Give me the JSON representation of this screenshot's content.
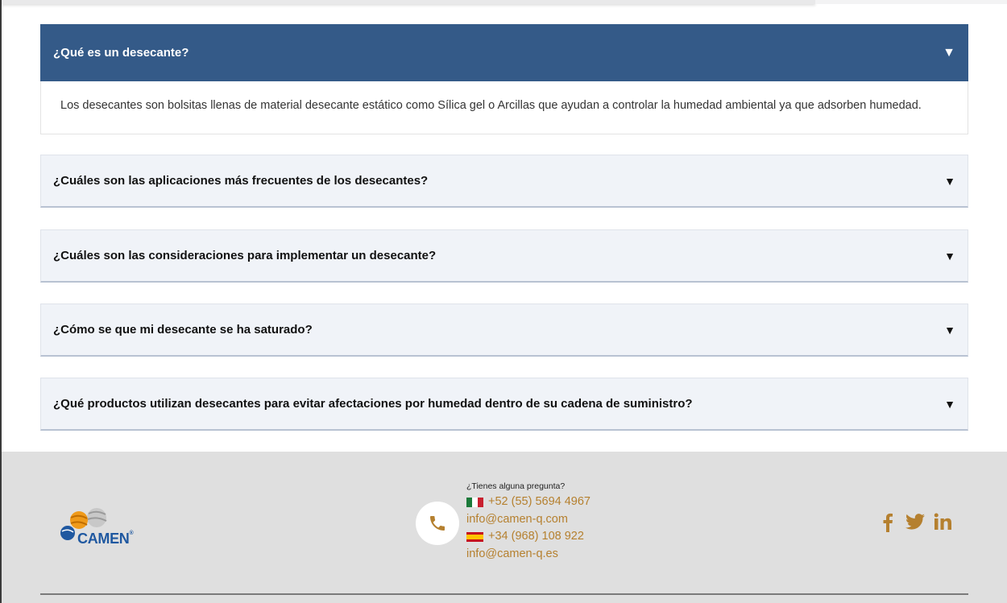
{
  "faq": [
    {
      "question": "¿Qué es un desecante?",
      "open": true,
      "answer": "Los desecantes son bolsitas llenas de material desecante estático como Sílica gel o Arcillas que ayudan a controlar la humedad ambiental ya que adsorben humedad."
    },
    {
      "question": "¿Cuáles son las aplicaciones más frecuentes de los desecantes?",
      "open": false
    },
    {
      "question": "¿Cuáles son las consideraciones para implementar un desecante?",
      "open": false
    },
    {
      "question": "¿Cómo se que mi desecante se ha saturado?",
      "open": false
    },
    {
      "question": "¿Qué productos utilizan desecantes para evitar afectaciones por humedad dentro de su cadena de suministro?",
      "open": false
    }
  ],
  "arrow_glyph": "▼",
  "footer": {
    "logo_text": "CAMEN",
    "logo_reg": "®",
    "contact_question": "¿Tienes alguna pregunta?",
    "mexico_phone": "+52 (55) 5694 4967",
    "mexico_email": "info@camen-q.com",
    "spain_phone": "+34 (968) 108 922",
    "spain_email": "info@camen-q.es",
    "social": [
      "facebook-icon",
      "twitter-icon",
      "linkedin-icon"
    ]
  },
  "colors": {
    "accent_blue": "#345a88",
    "gold": "#b5802f",
    "footer_bg": "#dfdfdf"
  }
}
